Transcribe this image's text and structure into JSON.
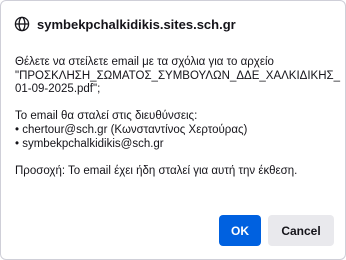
{
  "dialog": {
    "origin": {
      "icon": "globe-icon",
      "text": "symbekpchalkidikis.sites.sch.gr"
    },
    "message_lines": [
      "Θέλετε να στείλετε email με τα σχόλια για το αρχείο",
      "\"ΠΡΟΣΚΛΗΣΗ_ΣΩΜΑΤΟΣ_ΣΥΜΒΟΥΛΩΝ_ΔΔΕ_ΧΑΛΚΙΔΙΚΗΣ_",
      "01-09-2025.pdf\";",
      "",
      "Το email θα σταλεί στις διευθύνσεις:",
      "• chertour@sch.gr (Κωνσταντίνος Χερτούρας)",
      "• symbekpchalkidikis@sch.gr",
      "",
      "Προσοχή: Το email έχει ήδη σταλεί για αυτή την έκθεση."
    ],
    "buttons": {
      "ok_label": "OK",
      "cancel_label": "Cancel"
    },
    "colors": {
      "primary_button": "#0061e0",
      "secondary_button": "#e9e9ed",
      "text": "#15141a"
    }
  }
}
